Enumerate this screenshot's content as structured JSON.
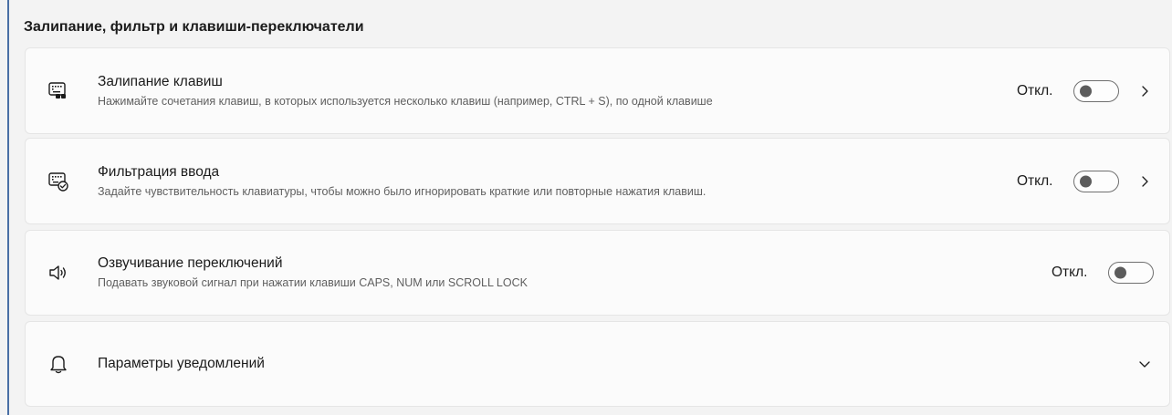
{
  "section": {
    "title": "Залипание, фильтр и клавиши-переключатели"
  },
  "cards": [
    {
      "id": "sticky-keys",
      "icon": "sticky-keys-icon",
      "title": "Залипание клавиш",
      "description": "Нажимайте сочетания клавиш, в которых используется несколько клавиш (например, CTRL + S), по одной клавише",
      "state": "Откл.",
      "toggle_on": false,
      "has_chevron": true
    },
    {
      "id": "filter-keys",
      "icon": "filter-keys-icon",
      "title": "Фильтрация ввода",
      "description": "Задайте чувствительность клавиатуры, чтобы можно было игнорировать краткие или повторные нажатия клавиш.",
      "state": "Откл.",
      "toggle_on": false,
      "has_chevron": true
    },
    {
      "id": "toggle-keys",
      "icon": "speaker-icon",
      "title": "Озвучивание переключений",
      "description": "Подавать звуковой сигнал при нажатии клавиши CAPS, NUM или SCROLL LOCK",
      "state": "Откл.",
      "toggle_on": false,
      "has_chevron": false
    },
    {
      "id": "notifications",
      "icon": "bell-icon",
      "title": "Параметры уведомлений",
      "expandable": true
    }
  ],
  "colors": {
    "page_bg": "#f3f3f3",
    "card_bg": "#fbfbfb",
    "card_border": "#e5e5e5",
    "text_primary": "#1b1b1b",
    "text_secondary": "#5f5f5f",
    "toggle_border": "#6f6f6f",
    "window_edge": "#4a6fa5"
  }
}
